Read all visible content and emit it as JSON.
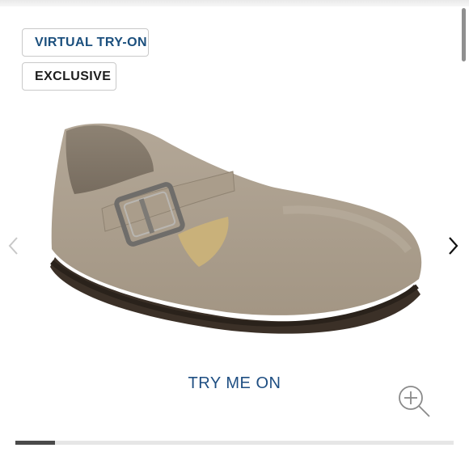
{
  "badges": {
    "virtual_try_on": "VIRTUAL TRY-ON",
    "exclusive": "EXCLUSIVE"
  },
  "gallery": {
    "image_icon": "suede-clog-shoe",
    "progress_fraction": 0.09
  },
  "cta": {
    "try_me_on": "TRY ME ON"
  },
  "colors": {
    "accent": "#1e4e82",
    "border": "#c9c9c9",
    "progress_fill": "#4a4a4a",
    "progress_track": "#e6e6e6"
  }
}
